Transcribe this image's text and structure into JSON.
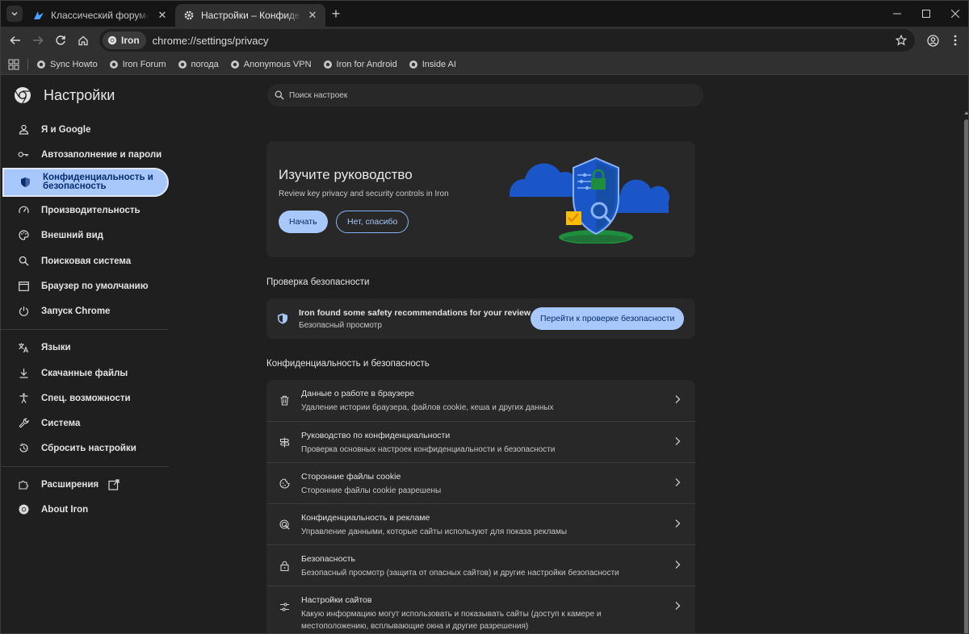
{
  "browser": {
    "tabs": [
      {
        "title": "Классический форум-трекер з",
        "favicon": "forum-icon",
        "active": false
      },
      {
        "title": "Настройки – Конфиденциальн",
        "favicon": "gear-icon",
        "active": true
      }
    ],
    "chip_label": "Iron",
    "url": "chrome://settings/privacy",
    "bookmarks": [
      {
        "label": "Sync Howto"
      },
      {
        "label": "Iron Forum"
      },
      {
        "label": "погода"
      },
      {
        "label": "Anonymous VPN"
      },
      {
        "label": "Iron for Android"
      },
      {
        "label": "Inside AI"
      }
    ]
  },
  "settings": {
    "title": "Настройки",
    "search_placeholder": "Поиск настроек",
    "nav": [
      {
        "label": "Я и Google",
        "icon": "person-icon"
      },
      {
        "label": "Автозаполнение и пароли",
        "icon": "key-icon"
      },
      {
        "label": "Конфиденциальность и безопасность",
        "icon": "shield-icon",
        "active": true
      },
      {
        "label": "Производительность",
        "icon": "speedometer-icon"
      },
      {
        "label": "Внешний вид",
        "icon": "palette-icon"
      },
      {
        "label": "Поисковая система",
        "icon": "search-icon"
      },
      {
        "label": "Браузер по умолчанию",
        "icon": "browser-window-icon"
      },
      {
        "label": "Запуск Chrome",
        "icon": "power-icon"
      },
      {
        "label": "Языки",
        "icon": "translate-icon"
      },
      {
        "label": "Скачанные файлы",
        "icon": "download-icon"
      },
      {
        "label": "Спец. возможности",
        "icon": "accessibility-icon"
      },
      {
        "label": "Система",
        "icon": "wrench-icon"
      },
      {
        "label": "Сбросить настройки",
        "icon": "reset-icon"
      },
      {
        "label": "Расширения",
        "icon": "puzzle-icon"
      },
      {
        "label": "About Iron",
        "icon": "chrome-icon"
      }
    ],
    "promo": {
      "heading": "Изучите руководство",
      "description": "Review key privacy and security controls in Iron",
      "start_label": "Начать",
      "dismiss_label": "Нет, спасибо"
    },
    "safety_check": {
      "section_title": "Проверка безопасности",
      "title": "Iron found some safety recommendations for your review",
      "subtitle": "Безопасный просмотр",
      "button_label": "Перейти к проверке безопасности"
    },
    "privacy": {
      "section_title": "Конфиденциальность и безопасность",
      "rows": [
        {
          "title": "Данные о работе в браузере",
          "desc": "Удаление истории браузера, файлов cookie, кеша и других данных",
          "icon": "trash-icon"
        },
        {
          "title": "Руководство по конфиденциальности",
          "desc": "Проверка основных настроек конфиденциальности и безопасности",
          "icon": "signpost-icon"
        },
        {
          "title": "Сторонние файлы cookie",
          "desc": "Сторонние файлы cookie разрешены",
          "icon": "cookie-icon"
        },
        {
          "title": "Конфиденциальность в рекламе",
          "desc": "Управление данными, которые сайты используют для показа рекламы",
          "icon": "ad-privacy-icon"
        },
        {
          "title": "Безопасность",
          "desc": "Безопасный просмотр (защита от опасных сайтов) и другие настройки безопасности",
          "icon": "lock-icon"
        },
        {
          "title": "Настройки сайтов",
          "desc": "Какую информацию могут использовать и показывать сайты (доступ к камере и местоположению, всплывающие окна и другие разрешения)",
          "icon": "sliders-icon"
        }
      ]
    }
  },
  "colors": {
    "accent": "#a8c7fa",
    "accent_text": "#062e6f",
    "background": "#1f1f1f",
    "card": "#282828"
  }
}
